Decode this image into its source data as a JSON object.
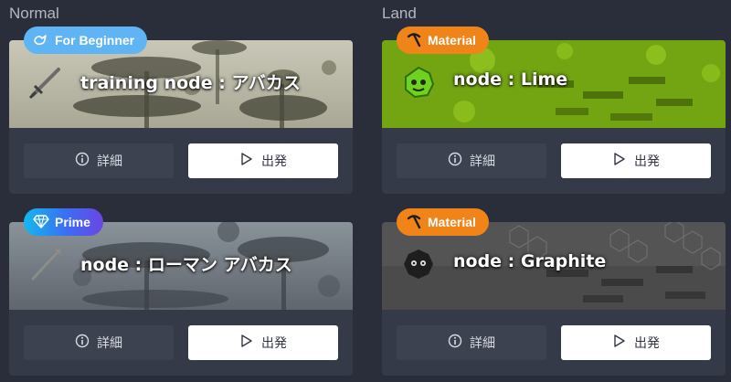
{
  "sections": {
    "normal": "Normal",
    "land": "Land"
  },
  "cards": [
    {
      "badge": "For Beginner",
      "badge_icon": "bird-icon",
      "title": "training node : アバカス",
      "detail_label": "詳細",
      "depart_label": "出発"
    },
    {
      "badge": "Material",
      "badge_icon": "pickaxe-icon",
      "title": "node : Lime",
      "detail_label": "詳細",
      "depart_label": "出発"
    },
    {
      "badge": "Prime",
      "badge_icon": "diamond-icon",
      "title": "node : ローマン アバカス",
      "detail_label": "詳細",
      "depart_label": "出発"
    },
    {
      "badge": "Material",
      "badge_icon": "pickaxe-icon",
      "title": "node : Graphite",
      "detail_label": "詳細",
      "depart_label": "出発"
    }
  ],
  "colors": {
    "background": "#2a2e3b",
    "card": "#353a48",
    "badge_beginner": "#5fb4f4",
    "badge_material": "#f08418",
    "badge_prime": "#3c6cf2",
    "lime_banner": "#7fb416",
    "graphite_banner": "#4a4b4a"
  }
}
